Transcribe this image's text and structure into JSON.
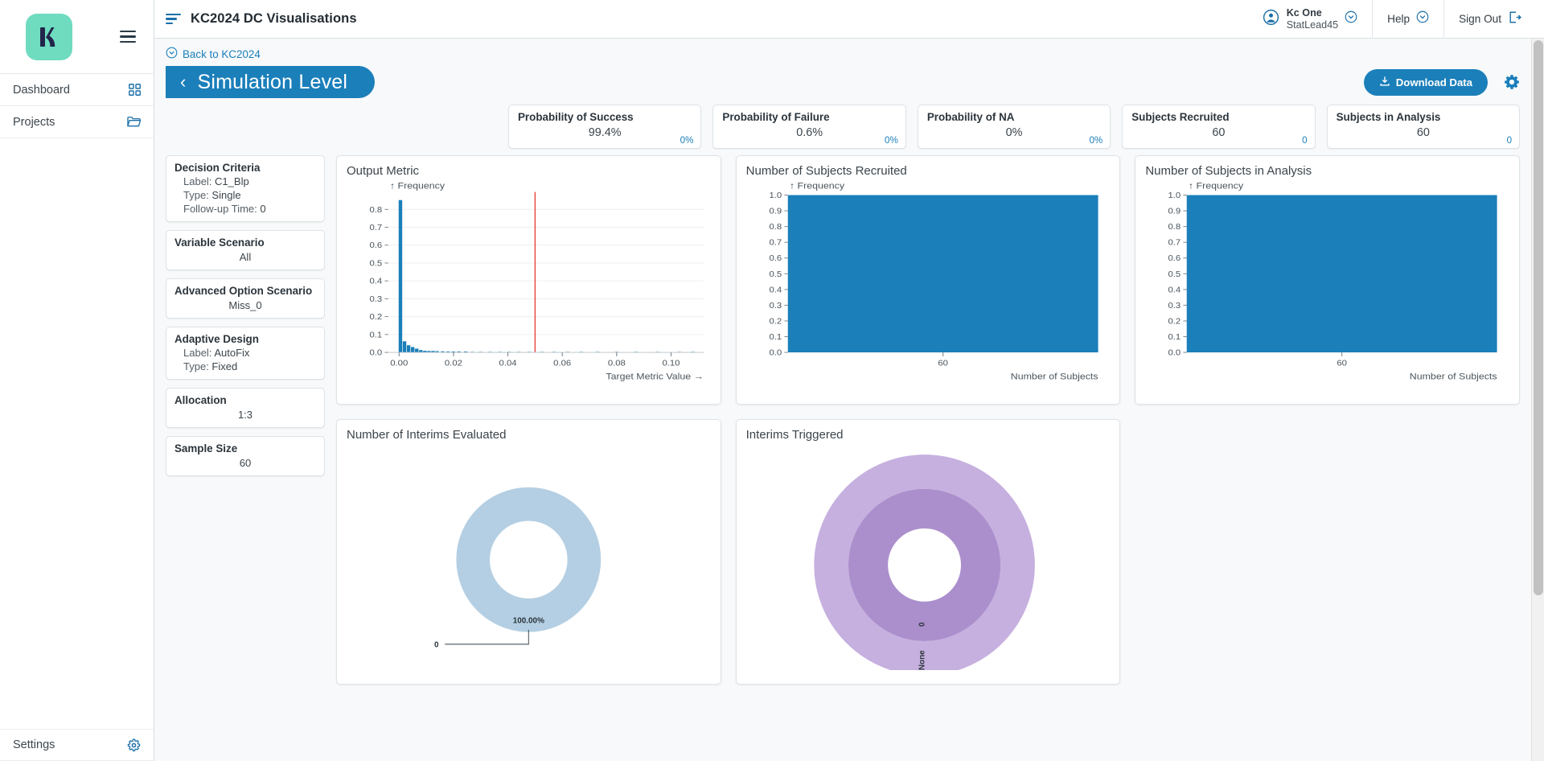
{
  "sidebar": {
    "logo_alt": "Kaleidoscope K logo",
    "logo_bg": "#6fdcc0",
    "logo_fg": "#22254a",
    "items": [
      {
        "label": "Dashboard",
        "icon": "grid-icon"
      },
      {
        "label": "Projects",
        "icon": "folder-icon"
      }
    ],
    "bottom": {
      "label": "Settings",
      "icon": "gear-icon"
    }
  },
  "topbar": {
    "title": "KC2024 DC Visualisations",
    "title_icon": "sort-lines-icon",
    "user": {
      "name": "Kc One",
      "role": "StatLead45",
      "icon": "user-circle-icon",
      "chevron": "chevron-down-icon"
    },
    "help": {
      "label": "Help",
      "chevron": "chevron-down-icon"
    },
    "signout": {
      "label": "Sign Out",
      "icon": "sign-out-icon"
    }
  },
  "breadcrumb": {
    "label": "Back to KC2024",
    "icon": "circle-chevron-down-icon"
  },
  "level": {
    "label": "Simulation Level",
    "back_chevron": "chevron-left-icon",
    "download_label": "Download Data",
    "download_icon": "download-icon",
    "settings_icon": "gear-icon",
    "accent": "#1b7fba"
  },
  "stats": [
    {
      "title": "Probability of Success",
      "value": "99.4%",
      "sub": "0%"
    },
    {
      "title": "Probability of Failure",
      "value": "0.6%",
      "sub": "0%"
    },
    {
      "title": "Probability of NA",
      "value": "0%",
      "sub": "0%"
    },
    {
      "title": "Subjects Recruited",
      "value": "60",
      "sub": "0"
    },
    {
      "title": "Subjects in Analysis",
      "value": "60",
      "sub": "0"
    }
  ],
  "info_cards": [
    {
      "title": "Decision Criteria",
      "rows": [
        {
          "key": "Label:",
          "val": "C1_Blp"
        },
        {
          "key": "Type:",
          "val": "Single"
        },
        {
          "key": "Follow-up Time:",
          "val": "0"
        }
      ]
    },
    {
      "title": "Variable Scenario",
      "value": "All"
    },
    {
      "title": "Advanced Option Scenario",
      "value": "Miss_0"
    },
    {
      "title": "Adaptive Design",
      "rows": [
        {
          "key": "Label:",
          "val": "AutoFix"
        },
        {
          "key": "Type:",
          "val": "Fixed"
        }
      ]
    },
    {
      "title": "Allocation",
      "value": "1:3"
    },
    {
      "title": "Sample Size",
      "value": "60"
    }
  ],
  "chart_data": [
    {
      "id": "output-metric",
      "type": "bar",
      "title": "Output Metric",
      "xlabel": "Target Metric Value →",
      "ylabel": "↑ Frequency",
      "bar_color": "#1b7fba",
      "grid": true,
      "xlim": [
        -0.004,
        0.112
      ],
      "ylim": [
        0,
        0.88
      ],
      "xticks": [
        0.0,
        0.02,
        0.04,
        0.06,
        0.08,
        0.1
      ],
      "xticklabels": [
        "0.00",
        "0.02",
        "0.04",
        "0.06",
        "0.08",
        "0.10"
      ],
      "yticks": [
        0.0,
        0.1,
        0.2,
        0.3,
        0.4,
        0.5,
        0.6,
        0.7,
        0.8
      ],
      "yticklabels": [
        "0.0",
        "0.1",
        "0.2",
        "0.3",
        "0.4",
        "0.5",
        "0.6",
        "0.7",
        "0.8"
      ],
      "x": [
        0.0005,
        0.002,
        0.0035,
        0.005,
        0.0065,
        0.008,
        0.0095,
        0.011,
        0.0125,
        0.014,
        0.016,
        0.018,
        0.02,
        0.022,
        0.0245,
        0.027,
        0.03,
        0.0335,
        0.037,
        0.0405,
        0.044,
        0.048,
        0.0525,
        0.057,
        0.062,
        0.067,
        0.073,
        0.08,
        0.087,
        0.095,
        0.103,
        0.108
      ],
      "values": [
        0.852,
        0.062,
        0.04,
        0.03,
        0.021,
        0.013,
        0.009,
        0.008,
        0.008,
        0.007,
        0.006,
        0.005,
        0.005,
        0.004,
        0.004,
        0.003,
        0.003,
        0.003,
        0.003,
        0.002,
        0.002,
        0.002,
        0.002,
        0.002,
        0.002,
        0.002,
        0.002,
        0.003,
        0.002,
        0.002,
        0.003,
        0.002
      ],
      "threshold": {
        "value": 0.05,
        "color": "#e8453c",
        "label": ""
      }
    },
    {
      "id": "subjects-recruited",
      "type": "bar",
      "title": "Number of Subjects Recruited",
      "xlabel": "Number of Subjects",
      "ylabel": "↑ Frequency",
      "bar_color": "#1b7fba",
      "grid": false,
      "categories": [
        "60"
      ],
      "values": [
        1.0
      ],
      "ylim": [
        0,
        1.0
      ],
      "yticks": [
        0.0,
        0.1,
        0.2,
        0.3,
        0.4,
        0.5,
        0.6,
        0.7,
        0.8,
        0.9,
        1.0
      ],
      "yticklabels": [
        "0.0",
        "0.1",
        "0.2",
        "0.3",
        "0.4",
        "0.5",
        "0.6",
        "0.7",
        "0.8",
        "0.9",
        "1.0"
      ],
      "xticklabels": [
        "60"
      ]
    },
    {
      "id": "subjects-in-analysis",
      "type": "bar",
      "title": "Number of Subjects in Analysis",
      "xlabel": "Number of Subjects",
      "ylabel": "↑ Frequency",
      "bar_color": "#1b7fba",
      "grid": false,
      "categories": [
        "60"
      ],
      "values": [
        1.0
      ],
      "ylim": [
        0,
        1.0
      ],
      "yticks": [
        0.0,
        0.1,
        0.2,
        0.3,
        0.4,
        0.5,
        0.6,
        0.7,
        0.8,
        0.9,
        1.0
      ],
      "yticklabels": [
        "0.0",
        "0.1",
        "0.2",
        "0.3",
        "0.4",
        "0.5",
        "0.6",
        "0.7",
        "0.8",
        "0.9",
        "1.0"
      ],
      "xticklabels": [
        "60"
      ]
    },
    {
      "id": "interims-evaluated",
      "type": "pie",
      "title": "Number of Interims Evaluated",
      "labels": [
        "0"
      ],
      "values": [
        100.0
      ],
      "value_labels": [
        "100.00%"
      ],
      "leader_label": "0",
      "colors": [
        "#b4cfe3"
      ],
      "donut": true
    },
    {
      "id": "interims-triggered",
      "type": "pie",
      "title": "Interims Triggered",
      "rings": [
        {
          "labels": [
            "0"
          ],
          "values": [
            100.0
          ],
          "color": "#ab8fcd"
        },
        {
          "labels": [
            "None"
          ],
          "values": [
            100.0
          ],
          "color": "#c6b0df"
        }
      ],
      "donut": true
    }
  ]
}
